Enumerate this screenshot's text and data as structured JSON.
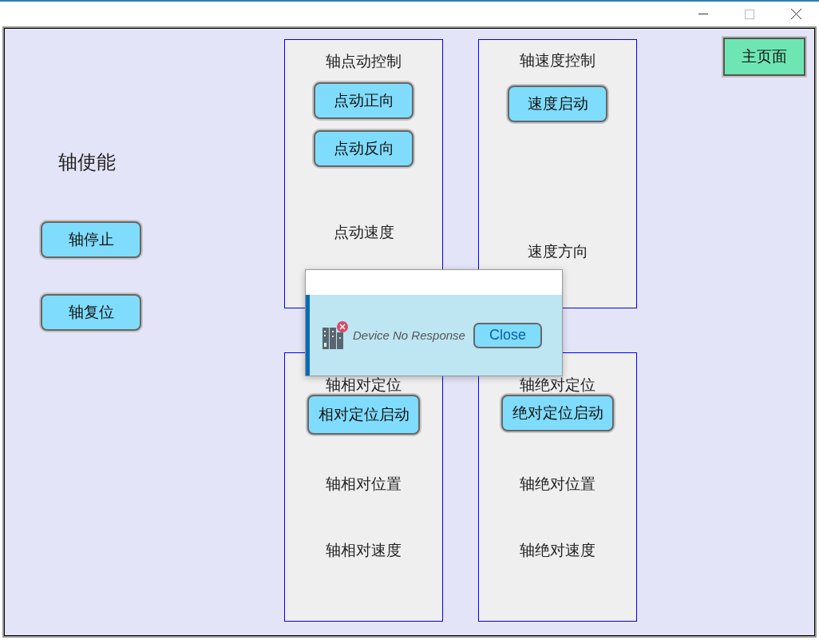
{
  "sidebar": {
    "title": "轴使能",
    "buttons": [
      "轴停止",
      "轴复位"
    ]
  },
  "panels": [
    {
      "title": "轴点动控制",
      "items": [
        {
          "kind": "button",
          "label": "点动正向"
        },
        {
          "kind": "button",
          "label": "点动反向"
        },
        {
          "kind": "label",
          "label": "点动速度"
        }
      ]
    },
    {
      "title": "轴速度控制",
      "items": [
        {
          "kind": "button",
          "label": "速度启动"
        },
        {
          "kind": "label",
          "label": "速度方向"
        }
      ]
    },
    {
      "title": "轴相对定位",
      "items": [
        {
          "kind": "button",
          "label": "相对定位启动"
        },
        {
          "kind": "label",
          "label": "轴相对位置"
        },
        {
          "kind": "label",
          "label": "轴相对速度"
        }
      ]
    },
    {
      "title": "轴绝对定位",
      "items": [
        {
          "kind": "button",
          "label": "绝对定位启动"
        },
        {
          "kind": "label",
          "label": "轴绝对位置"
        },
        {
          "kind": "label",
          "label": "轴绝对速度"
        }
      ]
    }
  ],
  "home_button": "主页面",
  "dialog": {
    "message": "Device No Response",
    "button": "Close"
  }
}
